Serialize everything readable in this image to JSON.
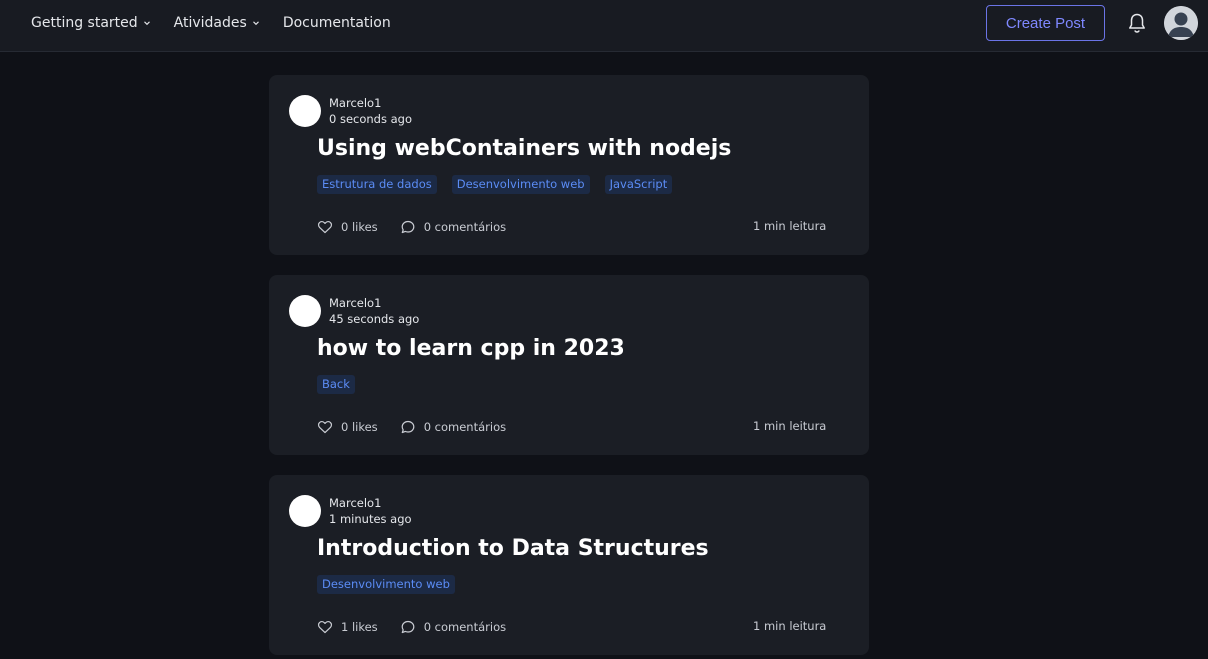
{
  "nav": {
    "items": [
      {
        "label": "Getting started",
        "has_dropdown": true
      },
      {
        "label": "Atividades",
        "has_dropdown": true
      },
      {
        "label": "Documentation",
        "has_dropdown": false
      }
    ],
    "create_label": "Create Post",
    "bell_icon": "bell-icon",
    "avatar_icon": "user-avatar-icon"
  },
  "colors": {
    "background": "#0f1117",
    "navbar": "#181b22",
    "card": "#1b1e25",
    "accent": "#7f88ff",
    "tag_bg": "#1c2a45",
    "tag_text": "#5b8cf5"
  },
  "posts": [
    {
      "author": "Marcelo1",
      "time": "0 seconds ago",
      "title": "Using webContainers with nodejs",
      "tags": [
        "Estrutura de dados",
        "Desenvolvimento web",
        "JavaScript"
      ],
      "likes": "0 likes",
      "comments": "0 comentários",
      "read_time": "1 min leitura"
    },
    {
      "author": "Marcelo1",
      "time": "45 seconds ago",
      "title": "how to learn cpp in 2023",
      "tags": [
        "Back"
      ],
      "likes": "0 likes",
      "comments": "0 comentários",
      "read_time": "1 min leitura"
    },
    {
      "author": "Marcelo1",
      "time": "1 minutes ago",
      "title": "Introduction to Data Structures",
      "tags": [
        "Desenvolvimento web"
      ],
      "likes": "1 likes",
      "comments": "0 comentários",
      "read_time": "1 min leitura"
    }
  ]
}
